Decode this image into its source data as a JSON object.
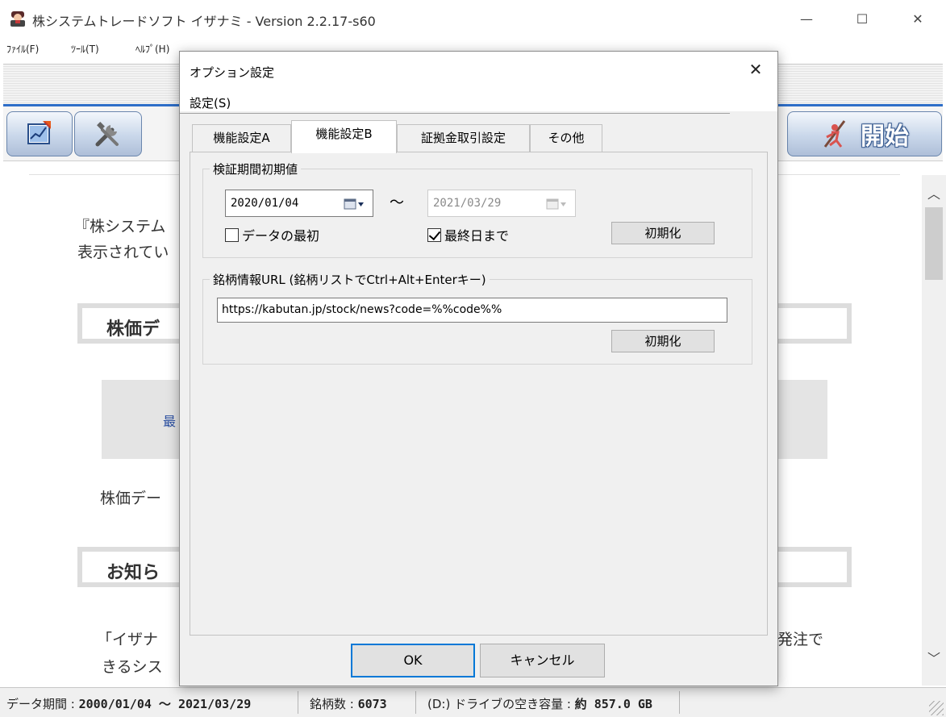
{
  "window": {
    "title": "株システムトレードソフト イザナミ - Version 2.2.17-s60",
    "minimize": "—",
    "maximize": "☐",
    "close": "✕"
  },
  "menubar": {
    "file": "ﾌｧｲﾙ(F)",
    "tools": "ﾂｰﾙ(T)",
    "help": "ﾍﾙﾌﾟ(H)"
  },
  "toolbar": {
    "start_label": "開始"
  },
  "content": {
    "line1": "『株システム",
    "line2": "表示されてい",
    "heading1": "株価デ",
    "notice": "最",
    "line3": "株価デー",
    "heading2": "お知ら",
    "line4": "「イザナ",
    "line4_right": "発注で",
    "line5": "きるシス"
  },
  "statusbar": {
    "period_label": "データ期間 : ",
    "period_value": "2000/01/04 ～ 2021/03/29",
    "count_label": "銘柄数 : ",
    "count_value": "6073",
    "drive_label": "(D:) ドライブの空き容量 : ",
    "drive_value": "約 857.0 GB"
  },
  "dialog": {
    "title": "オプション設定",
    "close": "✕",
    "menu_settings": "設定(S)",
    "tabs": [
      {
        "label": "機能設定A",
        "active": false
      },
      {
        "label": "機能設定B",
        "active": true
      },
      {
        "label": "証拠金取引設定",
        "active": false
      },
      {
        "label": "その他",
        "active": false
      }
    ],
    "period_group": {
      "title": "検証期間初期値",
      "from_date": "2020/01/04",
      "tilde": "～",
      "to_date": "2021/03/29",
      "from_first_label": "データの最初",
      "from_first_checked": false,
      "to_last_label": "最終日まで",
      "to_last_checked": true,
      "reset_label": "初期化"
    },
    "url_group": {
      "title": "銘柄情報URL (銘柄リストでCtrl+Alt+Enterキー)",
      "url_value": "https://kabutan.jp/stock/news?code=%%code%%",
      "reset_label": "初期化"
    },
    "ok_label": "OK",
    "cancel_label": "キャンセル"
  }
}
